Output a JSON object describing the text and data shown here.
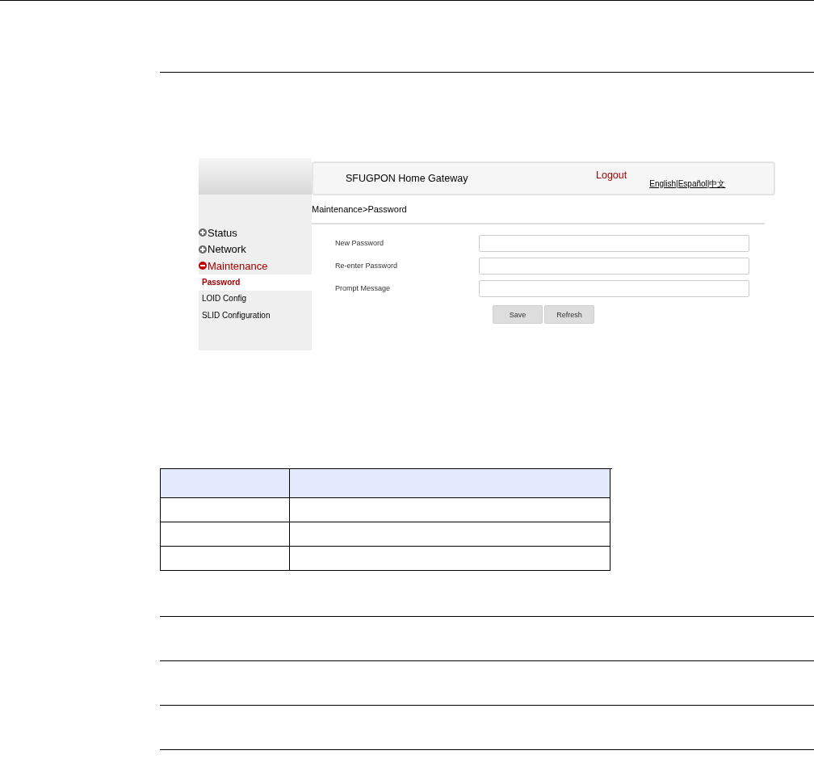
{
  "header": {
    "title": "SFUGPON Home Gateway",
    "logout": "Logout",
    "separator": "|",
    "languages": [
      "English",
      "Español",
      "中文"
    ]
  },
  "sidebar": {
    "items": [
      {
        "label": "Status",
        "expanded": false
      },
      {
        "label": "Network",
        "expanded": false
      },
      {
        "label": "Maintenance",
        "expanded": true,
        "children": [
          {
            "label": "Password",
            "selected": true
          },
          {
            "label": "LOID Config",
            "selected": false
          },
          {
            "label": "SLID Configuration",
            "selected": false
          }
        ]
      }
    ]
  },
  "breadcrumb": "Maintenance>Password",
  "form": {
    "fields": [
      {
        "label": "New Password"
      },
      {
        "label": "Re-enter Password"
      },
      {
        "label": "Prompt Message"
      }
    ],
    "buttons": [
      "Save",
      "Refresh"
    ]
  }
}
